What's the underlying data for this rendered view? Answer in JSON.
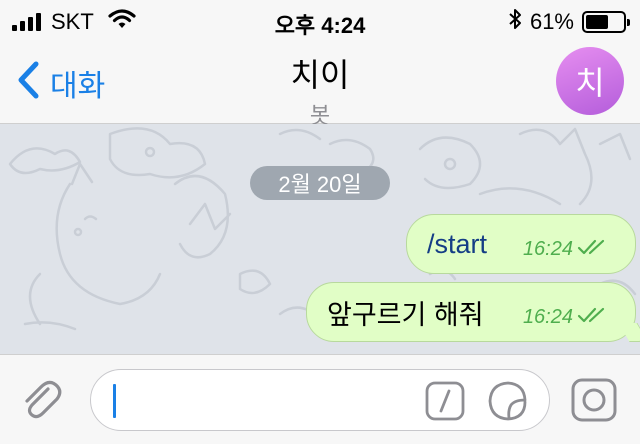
{
  "status_bar": {
    "carrier": "SKT",
    "time": "오후 4:24",
    "battery_percent": "61%",
    "battery_level": 0.61,
    "icons": [
      "signal-icon",
      "wifi-icon",
      "bluetooth-icon",
      "battery-icon"
    ]
  },
  "nav": {
    "back_label": "대화",
    "title": "치이",
    "subtitle": "봇",
    "avatar_letter": "치"
  },
  "chat": {
    "date_label": "2월 20일",
    "messages": [
      {
        "text": "/start",
        "time": "16:24",
        "status": "read"
      },
      {
        "text": "앞구르기 해줘",
        "time": "16:24",
        "status": "read"
      }
    ]
  },
  "input": {
    "placeholder": "",
    "icons": [
      "paperclip-icon",
      "command-icon",
      "sticker-icon",
      "camera-icon"
    ]
  },
  "colors": {
    "accent": "#1a80e6",
    "bubble_outgoing": "#e1fec6",
    "read_check": "#4fae4e",
    "chat_background": "#dfe3e9",
    "avatar_gradient": "#c66fe3"
  }
}
